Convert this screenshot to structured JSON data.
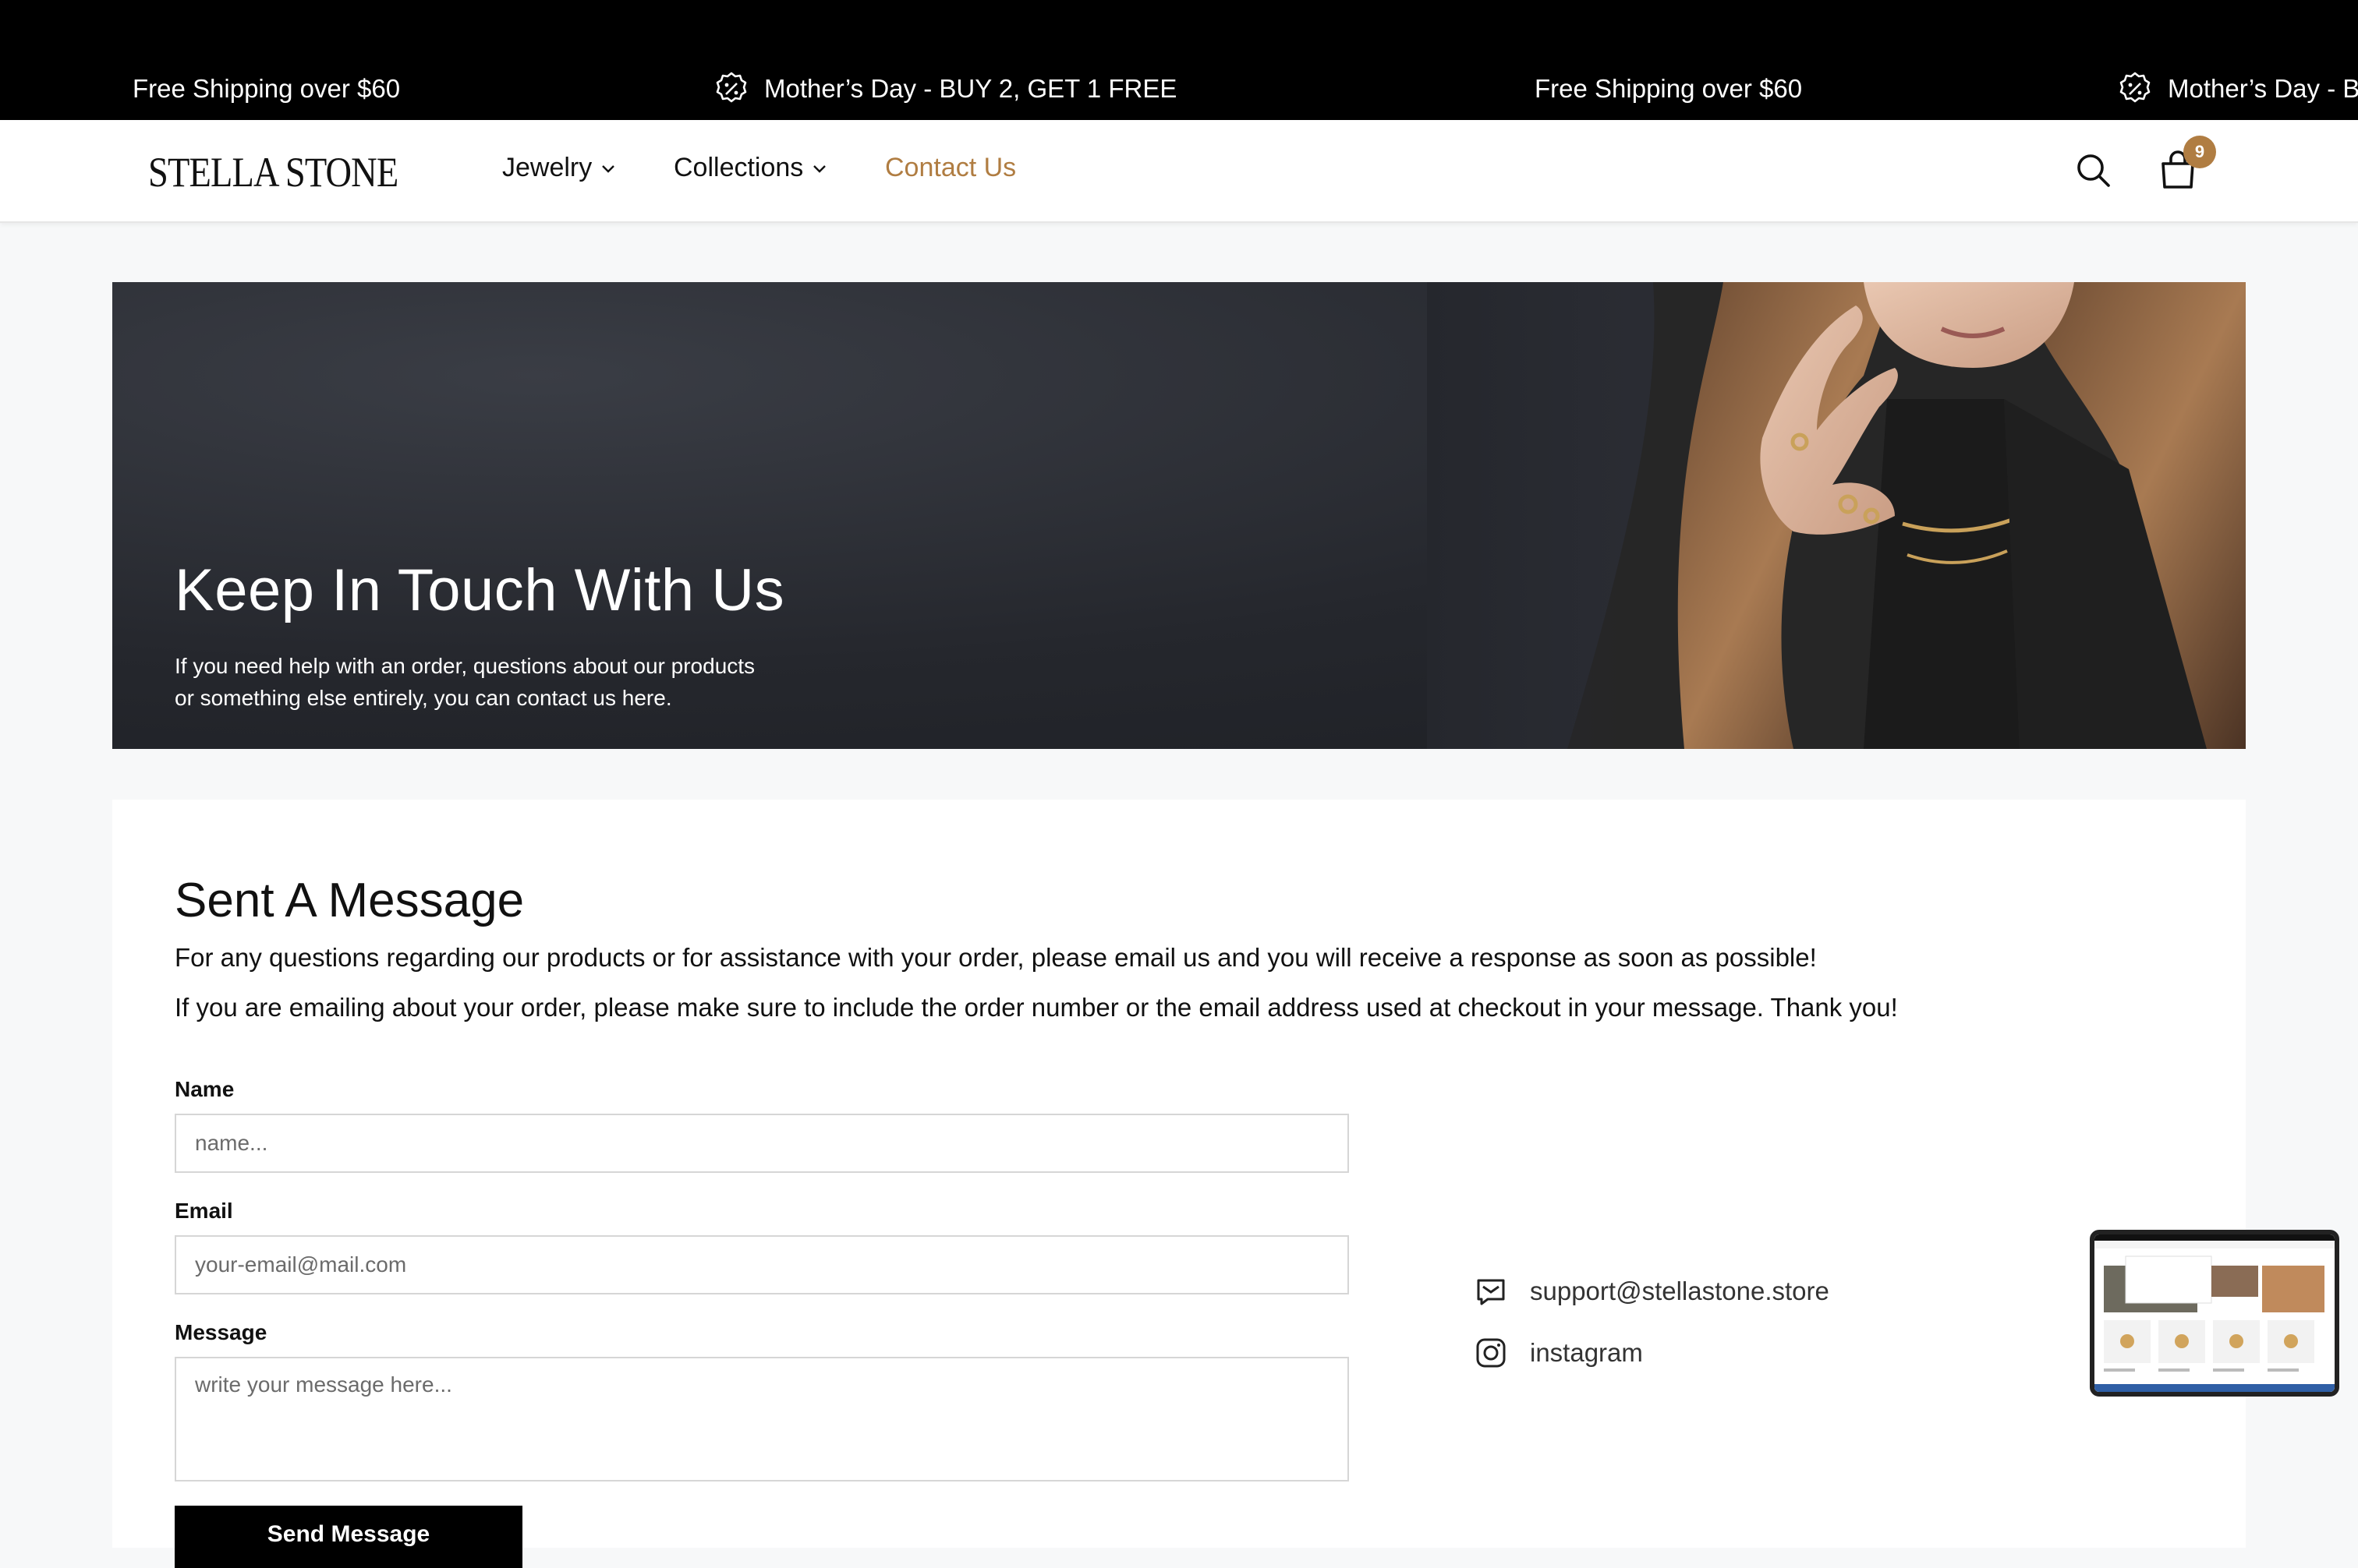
{
  "announcement": {
    "items": [
      {
        "text": "Free Shipping over $60",
        "icon": ""
      },
      {
        "text": "Mother’s Day - BUY 2, GET 1 FREE",
        "icon": "discount-badge-icon"
      },
      {
        "text": "Free Shipping over $60",
        "icon": ""
      },
      {
        "text": "Mother’s Day - B",
        "icon": "discount-badge-icon"
      }
    ]
  },
  "header": {
    "logo": "STELLA STONE",
    "nav": [
      {
        "label": "Jewelry",
        "has_dropdown": true
      },
      {
        "label": "Collections",
        "has_dropdown": true
      },
      {
        "label": "Contact Us",
        "active": true
      }
    ],
    "cart_count": "9",
    "accent_color": "#b07d42"
  },
  "hero": {
    "title": "Keep In Touch With Us",
    "subtitle_line1": "If you need help with an order, questions about our products",
    "subtitle_line2": "or something else entirely, you can contact us here."
  },
  "contact": {
    "title": "Sent A Message",
    "paragraph1": "For any questions regarding our products or for assistance with your order, please email us and you will receive a response as soon as possible!",
    "paragraph2": "If you are emailing about your order, please make sure to include the order number or the email address used at checkout in your message. Thank you!",
    "form": {
      "name_label": "Name",
      "name_placeholder": "name...",
      "email_label": "Email",
      "email_placeholder": "your-email@mail.com",
      "message_label": "Message",
      "message_placeholder": "write your message here...",
      "submit_label": "Send Message"
    },
    "links": {
      "email": "support@stellastone.store",
      "instagram": "instagram"
    }
  }
}
